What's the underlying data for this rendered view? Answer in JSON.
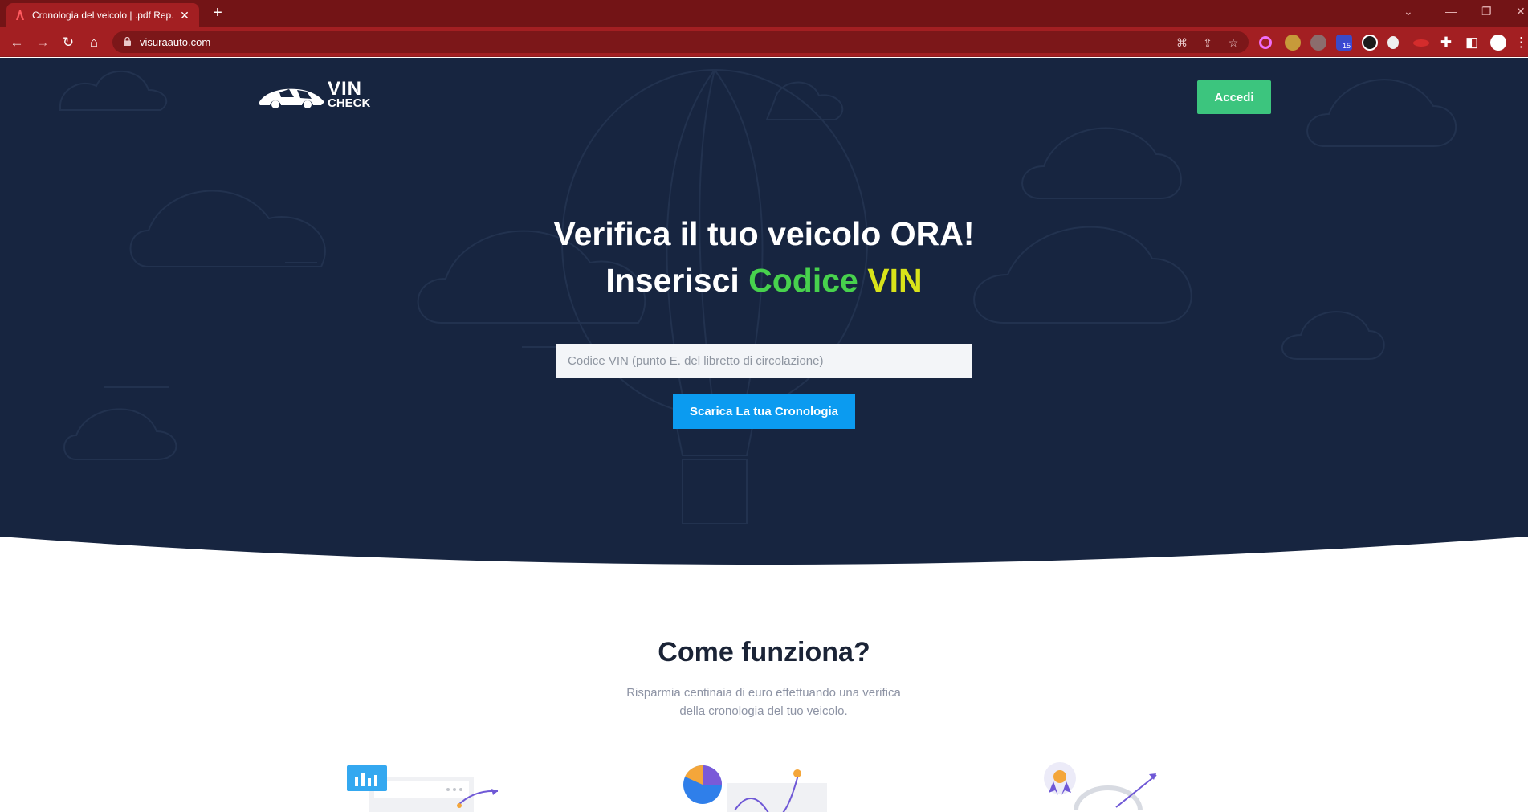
{
  "browser": {
    "tab_title": "Cronologia del veicolo | .pdf Rep...",
    "url": "visuraauto.com",
    "extension_badge": "15",
    "icons": [
      "back-icon",
      "forward-icon",
      "reload-icon",
      "home-icon",
      "lock-icon",
      "translate-icon",
      "share-icon",
      "star-icon",
      "extensions-icon",
      "sidepanel-icon",
      "profile-icon",
      "menu-icon"
    ]
  },
  "header": {
    "logo_top": "VIN",
    "logo_bottom": "CHECK",
    "login_label": "Accedi",
    "login_color": "#3cc57e"
  },
  "hero": {
    "line1": "Verifica il tuo veicolo ORA!",
    "line2_prefix": "Inserisci ",
    "line2_green": "Codice",
    "line2_yellow": "VIN",
    "input_placeholder": "Codice VIN (punto E. del libretto di circolazione)",
    "button_label": "Scarica La tua Cronologia",
    "bg_color": "#172540",
    "green_color": "#47d14d",
    "yellow_color": "#d9e31a",
    "button_color": "#0b9bf0"
  },
  "how": {
    "title": "Come funziona?",
    "subtitle_line1": "Risparmia centinaia di euro effettuando una verifica",
    "subtitle_line2": "della cronologia del tuo veicolo."
  }
}
